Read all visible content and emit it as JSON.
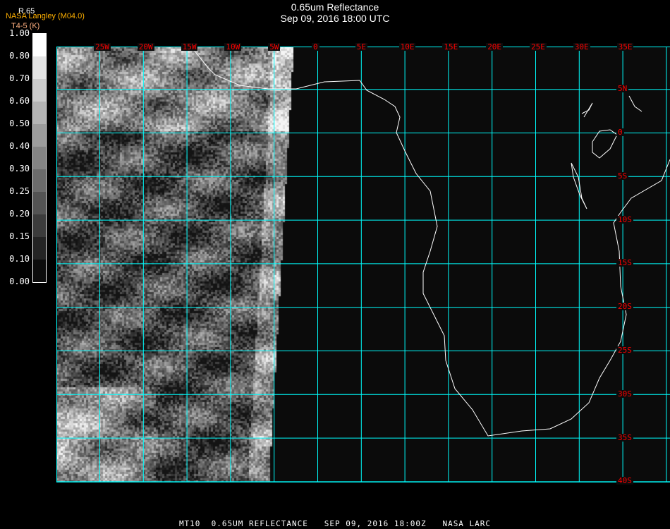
{
  "header": {
    "title": "0.65um Reflectance",
    "datetime": "Sep 09, 2016 18:00 UTC",
    "organization": "NASA Langley (M04.0)",
    "product_label": "R.65",
    "unit_label": "T4-5 (K)"
  },
  "colorbar": {
    "labels": [
      "1.00",
      "0.80",
      "0.70",
      "0.60",
      "0.50",
      "0.40",
      "0.30",
      "0.25",
      "0.20",
      "0.15",
      "0.10",
      "0.00"
    ],
    "colors": [
      "#ffffff",
      "#e4e4e4",
      "#cccccc",
      "#b4b4b4",
      "#9c9c9c",
      "#848484",
      "#6c6c6c",
      "#545454",
      "#3c3c3c",
      "#242424",
      "#0c0c0c"
    ]
  },
  "map": {
    "grid_color": "#00ffff",
    "coast_color": "#ffffff",
    "label_color": "#ff0000",
    "longitude_labels": [
      "25W",
      "20W",
      "15W",
      "10W",
      "5W",
      "0",
      "5E",
      "10E",
      "15E",
      "20E",
      "25E",
      "30E",
      "35E"
    ],
    "latitude_labels": [
      "5N",
      "0",
      "5S",
      "10S",
      "15S",
      "20S",
      "25S",
      "30S",
      "35S",
      "40S"
    ]
  },
  "footer": {
    "text": "MT10  0.65UM REFLECTANCE   SEP 09, 2016 18:00Z   NASA LARC"
  }
}
